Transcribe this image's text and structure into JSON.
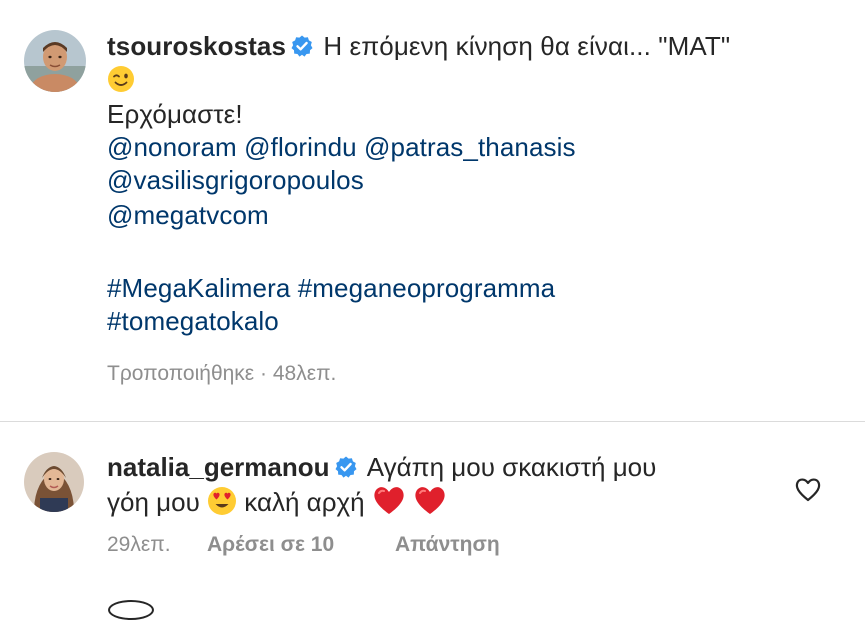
{
  "post": {
    "username": "tsouroskostas",
    "verified_icon": "verified-badge-icon",
    "caption_line1": "Η επόμενη κίνηση θα είναι... \"ΜΑΤ\"",
    "caption_line2": "Ερχόμαστε!",
    "mentions_line1": "@nonoram @florindu @patras_thanasis",
    "mentions_line2": "@vasilisgrigoropoulos",
    "mentions_line3": "@megatvcom",
    "hashtags_line1": "#MegaKalimera #meganeoprogramma",
    "hashtags_line2": "#tomegatokalo",
    "edited_label": "Τροποποιήθηκε",
    "separator": " · ",
    "time": "48λεπ."
  },
  "comment": {
    "username": "natalia_germanou",
    "text_part1": "Αγάπη μου σκακιστή μου",
    "text_part2": "γόη μου",
    "text_part3": "καλή αρχή",
    "time": "29λεπ.",
    "likes": "Αρέσει σε 10",
    "reply": "Απάντηση"
  },
  "icons": {
    "wink": "wink-emoji-icon",
    "heart_eyes": "heart-eyes-emoji-icon",
    "red_heart": "red-heart-emoji-icon",
    "like": "heart-outline-icon"
  },
  "colors": {
    "text": "#262626",
    "link": "#00376b",
    "muted": "#8e8e8e",
    "verified": "#3897f0",
    "heart": "#e0202c"
  }
}
